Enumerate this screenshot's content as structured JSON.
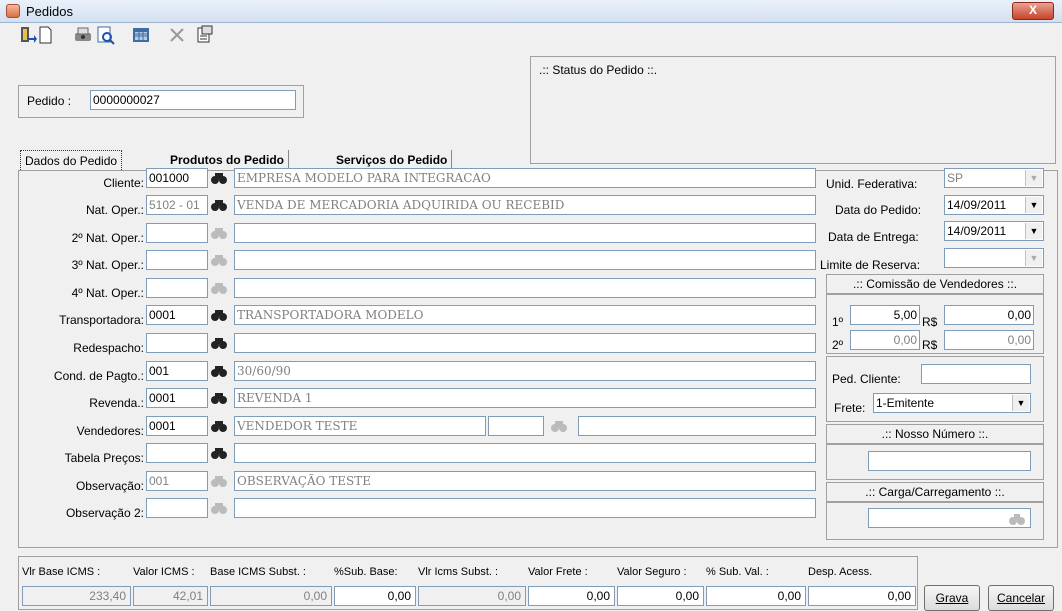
{
  "window": {
    "title": "Pedidos",
    "close_label": "X"
  },
  "toolbar": [
    "exit-icon",
    "new-document-icon",
    "print-icon",
    "preview-icon",
    "calendar-grid-icon",
    "delete-icon",
    "properties-icon"
  ],
  "status": {
    "label": ".:: Status do Pedido ::."
  },
  "pedido": {
    "label": "Pedido :",
    "value": "0000000027"
  },
  "tabs": [
    "Dados do Pedido",
    "Produtos do Pedido",
    "Serviços do Pedido"
  ],
  "form": {
    "cliente": {
      "label": "Cliente:",
      "code": "001000",
      "desc": "EMPRESA MODELO PARA INTEGRACAO"
    },
    "nat_oper": {
      "label": "Nat. Oper.:",
      "code": "5102 - 01",
      "desc": "VENDA DE MERCADORIA ADQUIRIDA OU RECEBID"
    },
    "nat2": {
      "label": "2º Nat. Oper.:",
      "code": "",
      "desc": ""
    },
    "nat3": {
      "label": "3º Nat. Oper.:",
      "code": "",
      "desc": ""
    },
    "nat4": {
      "label": "4º Nat. Oper.:",
      "code": "",
      "desc": ""
    },
    "transportadora": {
      "label": "Transportadora:",
      "code": "0001",
      "desc": "TRANSPORTADORA MODELO"
    },
    "redespacho": {
      "label": "Redespacho:",
      "code": "",
      "desc": ""
    },
    "cond_pagto": {
      "label": "Cond. de Pagto.:",
      "code": "001",
      "desc": "30/60/90"
    },
    "revenda": {
      "label": "Revenda.:",
      "code": "0001",
      "desc": "REVENDA 1"
    },
    "vendedores": {
      "label": "Vendedores:",
      "code": "0001",
      "desc": "VENDEDOR TESTE",
      "code2": "",
      "desc2": ""
    },
    "tabela": {
      "label": "Tabela Preços:",
      "code": "",
      "desc": ""
    },
    "observacao": {
      "label": "Observação:",
      "code": "001",
      "desc": "OBSERVAÇÃO TESTE"
    },
    "observacao2": {
      "label": "Observação 2:",
      "code": "",
      "desc": ""
    }
  },
  "right": {
    "uf": {
      "label": "Unid. Federativa:",
      "value": "SP"
    },
    "data_pedido": {
      "label": "Data do Pedido:",
      "value": "14/09/2011"
    },
    "data_entrega": {
      "label": "Data de Entrega:",
      "value": "14/09/2011"
    },
    "limite": {
      "label": "Limite de Reserva:",
      "value": ""
    },
    "comissao": {
      "header": ".:: Comissão de Vendedores ::.",
      "r1_label": "1º",
      "r1_pct": "5,00",
      "r1_cur": "R$",
      "r1_val": "0,00",
      "r2_label": "2º",
      "r2_pct": "0,00",
      "r2_cur": "R$",
      "r2_val": "0,00"
    },
    "ped_cliente": {
      "label": "Ped. Cliente:",
      "value": ""
    },
    "frete": {
      "label": "Frete:",
      "value": "1-Emitente"
    },
    "nosso_numero": {
      "header": ".:: Nosso Número ::.",
      "value": ""
    },
    "carga": {
      "header": ".:: Carga/Carregamento ::.",
      "value": ""
    }
  },
  "totals": {
    "headers": [
      "Vlr Base ICMS :",
      "Valor ICMS :",
      "Base ICMS Subst. :",
      "%Sub. Base:",
      "Vlr Icms Subst. :",
      "Valor Frete :",
      "Valor Seguro :",
      "% Sub. Val. :",
      "Desp. Acess."
    ],
    "values": [
      "233,40",
      "42,01",
      "0,00",
      "0,00",
      "0,00",
      "0,00",
      "0,00",
      "0,00",
      "0,00"
    ]
  },
  "buttons": {
    "grava": "Grava",
    "cancelar": "Cancelar"
  }
}
